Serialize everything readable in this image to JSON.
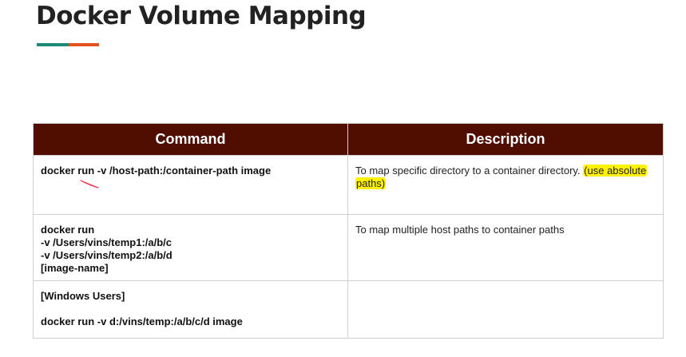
{
  "title": "Docker Volume Mapping",
  "colors": {
    "header_bg": "#4f0e00",
    "accent_teal": "#1f8a78",
    "accent_orange": "#e2531f",
    "highlight": "#fff200",
    "pen_mark": "#e8334a"
  },
  "table": {
    "headers": {
      "command": "Command",
      "description": "Description"
    },
    "rows": [
      {
        "command_lines": [
          "docker run -v /host-path:/container-path image"
        ],
        "description_text": "To map specific directory to a container directory.",
        "description_highlight_1": "(use absolute",
        "description_highlight_2": "paths)"
      },
      {
        "command_lines": [
          "docker run",
          "-v /Users/vins/temp1:/a/b/c",
          "-v /Users/vins/temp2:/a/b/d",
          "[image-name]"
        ],
        "description_text": "To map multiple host paths to container paths"
      },
      {
        "command_lines": [
          "[Windows Users]",
          "docker run -v d:/vins/temp:/a/b/c/d image"
        ],
        "description_text": ""
      }
    ]
  }
}
